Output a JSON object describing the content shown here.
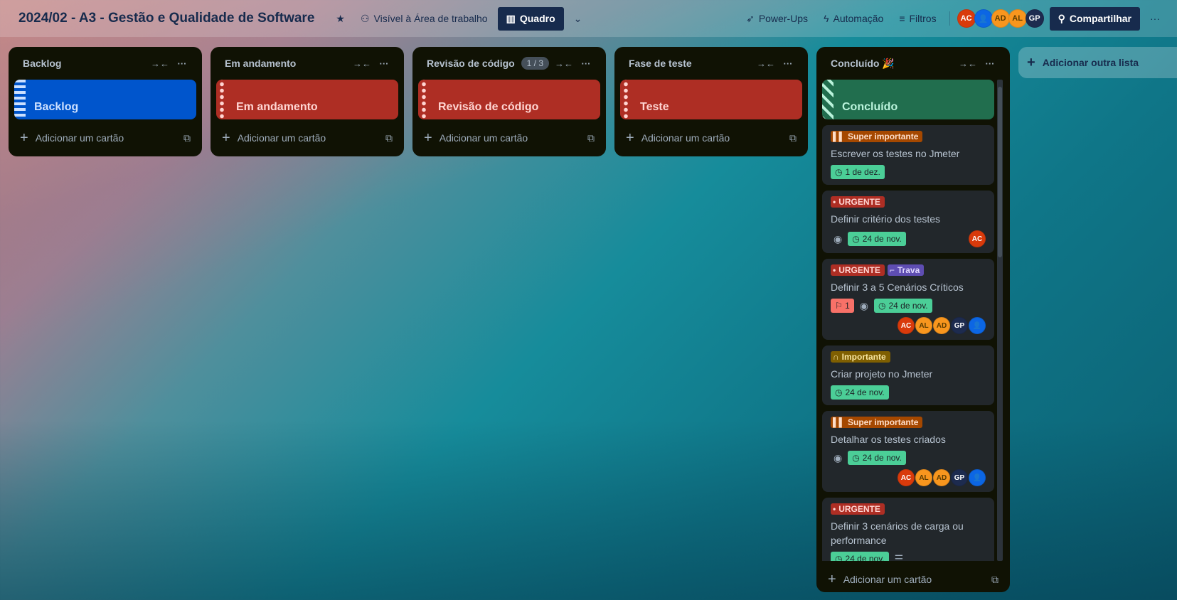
{
  "header": {
    "title": "2024/02 - A3 - Gestão e Qualidade de Software",
    "visibility": "Visível à Área de trabalho",
    "view": "Quadro",
    "powerups": "Power-Ups",
    "automation": "Automação",
    "filters": "Filtros",
    "share": "Compartilhar",
    "members": [
      "AC",
      "",
      "AD",
      "AL",
      "GP"
    ]
  },
  "lists": [
    {
      "name": "Backlog",
      "cover": "Backlog",
      "cover_color": "#0055cc"
    },
    {
      "name": "Em andamento",
      "cover": "Em andamento",
      "cover_color": "#ae2e24"
    },
    {
      "name": "Revisão de código",
      "badge": "1 / 3",
      "cover": "Revisão de código",
      "cover_color": "#ae2e24"
    },
    {
      "name": "Fase de teste",
      "cover": "Teste",
      "cover_color": "#ae2e24"
    },
    {
      "name": "Concluído 🎉",
      "cover": "Concluído",
      "cover_color": "#216e4e"
    }
  ],
  "add_card": "Adicionar um cartão",
  "add_list": "Adicionar outra lista",
  "cards": [
    {
      "labels": [
        "Super importante"
      ],
      "title": "Escrever os testes no Jmeter",
      "due": "1 de dez."
    },
    {
      "labels": [
        "URGENTE"
      ],
      "title": "Definir critério dos testes",
      "due": "24 de nov.",
      "members": [
        "AC"
      ]
    },
    {
      "labels": [
        "URGENTE",
        "Trava"
      ],
      "title": "Definir 3 a 5 Cenários Críticos",
      "votes": "1",
      "due": "24 de nov.",
      "members": [
        "AC",
        "AL",
        "AD",
        "GP",
        ""
      ]
    },
    {
      "labels": [
        "Importante"
      ],
      "title": "Criar projeto no Jmeter",
      "due": "24 de nov."
    },
    {
      "labels": [
        "Super importante"
      ],
      "title": "Detalhar os testes criados",
      "due": "24 de nov.",
      "members": [
        "AC",
        "AL",
        "AD",
        "GP",
        ""
      ]
    },
    {
      "labels": [
        "URGENTE"
      ],
      "title": "Definir 3 cenários de carga ou performance",
      "due": "24 de nov."
    }
  ]
}
